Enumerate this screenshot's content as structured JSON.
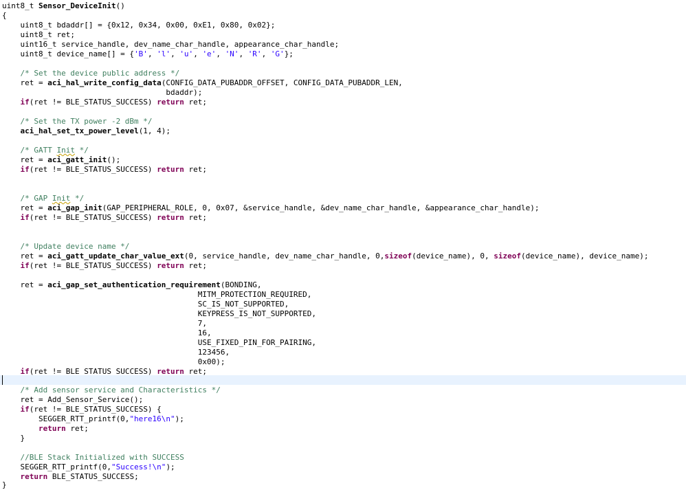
{
  "colors": {
    "keyword": "#7f0055",
    "comment": "#3f7f5f",
    "string": "#2a00ff",
    "current_line": "#e8f2fe"
  },
  "editor": {
    "l1": {
      "t1": "uint8_t ",
      "f": "Sensor_DeviceInit",
      "t2": "()"
    },
    "l2": "{",
    "l3": "    uint8_t bdaddr[] = {0x12, 0x34, 0x00, 0xE1, 0x80, 0x02};",
    "l4": "    uint8_t ret;",
    "l5": "    uint16_t service_handle, dev_name_char_handle, appearance_char_handle;",
    "l6": {
      "t1": "    uint8_t device_name[] = {",
      "c1": "'B'",
      "s": ", ",
      "c2": "'l'",
      "c3": "'u'",
      "c4": "'e'",
      "c5": "'N'",
      "c6": "'R'",
      "c7": "'G'",
      "t2": "};"
    },
    "l8": "    /* Set the device public address */",
    "l9": {
      "t1": "    ret = ",
      "f": "aci_hal_write_config_data",
      "t2": "(CONFIG_DATA_PUBADDR_OFFSET, CONFIG_DATA_PUBADDR_LEN,"
    },
    "l10": "                                    bdaddr);",
    "if_kw": "if",
    "ret_kw": "return",
    "if_mid": "(ret != BLE_STATUS_SUCCESS) ",
    "ret_tail": " ret;",
    "indent": "    ",
    "l13": "    /* Set the TX power -2 dBm */",
    "l14": {
      "t1": "    ",
      "f": "aci_hal_set_tx_power_level",
      "t2": "(1, 4);"
    },
    "l16": {
      "t1": "    /* GATT ",
      "sq": "Init",
      "t2": " */"
    },
    "l17": {
      "t1": "    ret = ",
      "f": "aci_gatt_init",
      "t2": "();"
    },
    "l21": {
      "t1": "    /* GAP ",
      "sq": "Init",
      "t2": " */"
    },
    "l22": {
      "t1": "    ret = ",
      "f": "aci_gap_init",
      "t2": "(GAP_PERIPHERAL_ROLE, 0, 0x07, &service_handle, &dev_name_char_handle, &appearance_char_handle);"
    },
    "l26": "    /* Update device name */",
    "l27": {
      "t1": "    ret = ",
      "f": "aci_gatt_update_char_value_ext",
      "t2": "(0, service_handle, dev_name_char_handle, 0,",
      "k": "sizeof",
      "t3": "(device_name), 0, ",
      "t4": "(device_name), device_name);"
    },
    "l30": {
      "t1": "    ret = ",
      "f": "aci_gap_set_authentication_requirement",
      "t2": "(BONDING,"
    },
    "l31": "                                           MITM_PROTECTION_REQUIRED,",
    "l32": "                                           SC_IS_NOT_SUPPORTED,",
    "l33": "                                           KEYPRESS_IS_NOT_SUPPORTED,",
    "l34": "                                           7,",
    "l35": "                                           16,",
    "l36": "                                           USE_FIXED_PIN_FOR_PAIRING,",
    "l37": "                                           123456,",
    "l38": "                                           0x00);",
    "l41": "    /* Add sensor service and Characteristics */",
    "l42": "    ret = Add_Sensor_Service();",
    "l43_tail": "(ret != BLE_STATUS_SUCCESS) {",
    "l44": {
      "t1": "        SEGGER_RTT_printf(0,",
      "s": "\"here16\\n\"",
      "t2": ");"
    },
    "l45_ind": "        ",
    "l46": "    }",
    "l48": "    //BLE Stack Initialized with SUCCESS",
    "l49": {
      "t1": "    SEGGER_RTT_printf(0,",
      "s": "\"Success!\\n\"",
      "t2": ");"
    },
    "l50_tail": " BLE_STATUS_SUCCESS;",
    "l51": "}"
  }
}
